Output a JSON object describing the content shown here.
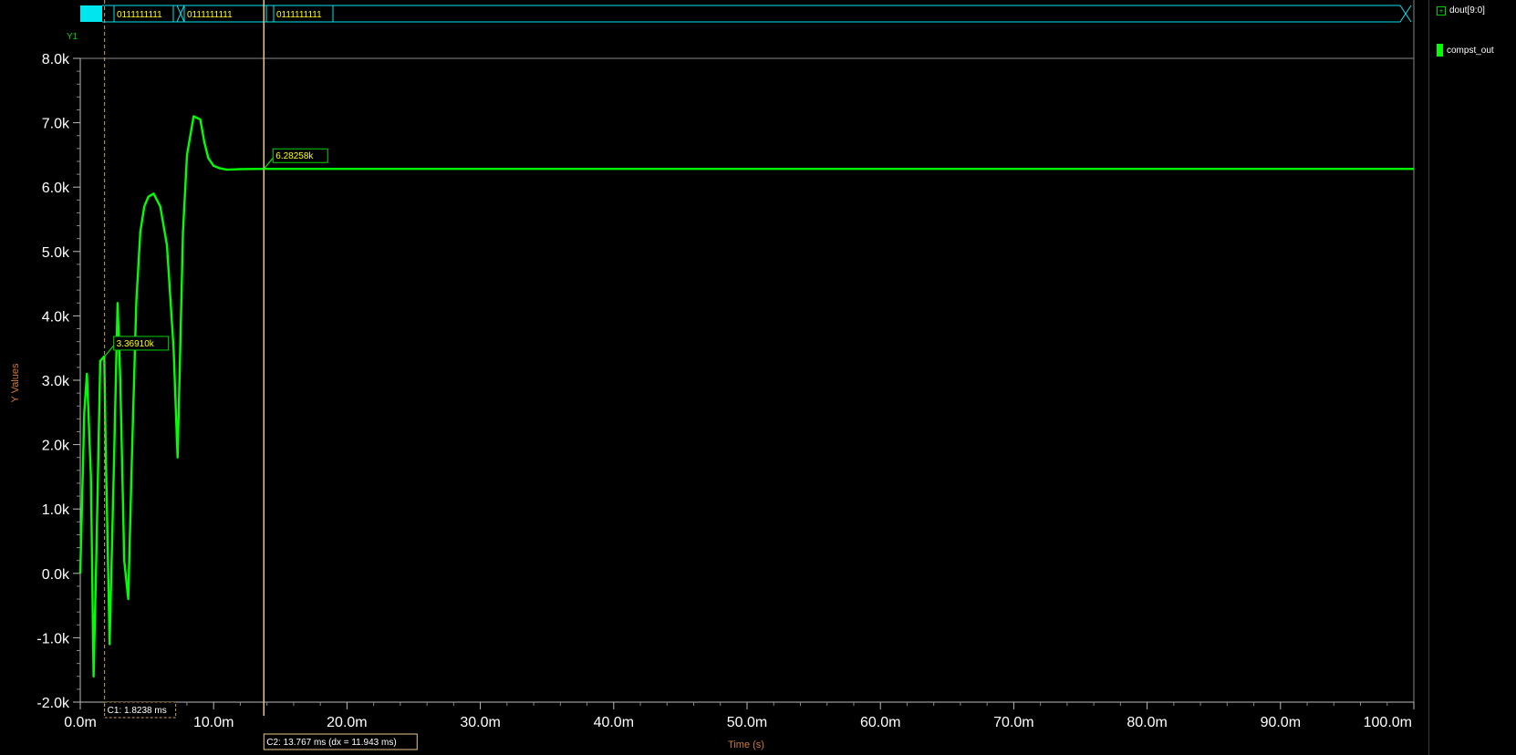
{
  "bus": {
    "values": [
      "0111111111",
      "0111111111",
      "0111111111"
    ],
    "color": "#00e5ee"
  },
  "legend": {
    "bus_name": "dout[9:0]",
    "signal_name": "compst_out",
    "expand_symbol": "+"
  },
  "cursors": {
    "c1": {
      "x_ms": 1.8238,
      "label": "C1: 1.8238 ms",
      "readout": "3.36910k",
      "style": "dashed"
    },
    "c2": {
      "x_ms": 13.767,
      "label": "C2: 13.767 ms (dx = 11.943 ms)",
      "readout": "6.28258k",
      "style": "solid"
    }
  },
  "colors": {
    "background": "#000000",
    "trace": "#00ff00",
    "bus": "#00e5ee",
    "cursor": "#c8a070",
    "readout": "#ffff00",
    "axis_label": "#d07a3a",
    "tick_text": "#ffffff"
  },
  "chart_data": {
    "type": "line",
    "title": "",
    "ylabel": "Y Values",
    "xlabel": "Time (s)",
    "axis_name": "Y1",
    "xlim": [
      0,
      100
    ],
    "ylim": [
      -2000,
      8000
    ],
    "x_unit": "ms",
    "y_ticks": [
      "8.0k",
      "7.0k",
      "6.0k",
      "5.0k",
      "4.0k",
      "3.0k",
      "2.0k",
      "1.0k",
      "0.0k",
      "-1.0k",
      "-2.0k"
    ],
    "y_tick_values": [
      8000,
      7000,
      6000,
      5000,
      4000,
      3000,
      2000,
      1000,
      0,
      -1000,
      -2000
    ],
    "x_ticks": [
      "0.0m",
      "10.0m",
      "20.0m",
      "30.0m",
      "40.0m",
      "50.0m",
      "60.0m",
      "70.0m",
      "80.0m",
      "90.0m",
      "100.0m"
    ],
    "x_tick_values": [
      0,
      10,
      20,
      30,
      40,
      50,
      60,
      70,
      80,
      90,
      100
    ],
    "grid": false,
    "series": [
      {
        "name": "compst_out",
        "x": [
          0,
          0.3,
          0.5,
          0.8,
          1.0,
          1.2,
          1.5,
          1.8,
          1.9,
          2.2,
          2.5,
          2.8,
          3.0,
          3.3,
          3.6,
          3.9,
          4.2,
          4.5,
          4.8,
          5.1,
          5.5,
          6.0,
          6.5,
          7.0,
          7.3,
          7.5,
          7.7,
          8.0,
          8.5,
          9.0,
          9.3,
          9.6,
          10.0,
          10.5,
          11.0,
          11.5,
          12.0,
          13.0,
          13.767,
          20,
          30,
          40,
          50,
          60,
          70,
          80,
          90,
          100
        ],
        "y": [
          0,
          2500,
          3100,
          1500,
          -1600,
          200,
          3300,
          3369,
          2000,
          -1100,
          1500,
          4200,
          3000,
          200,
          -400,
          2000,
          4200,
          5300,
          5700,
          5850,
          5900,
          5700,
          5100,
          3500,
          1800,
          3500,
          5300,
          6500,
          7100,
          7050,
          6700,
          6450,
          6330,
          6290,
          6270,
          6275,
          6280,
          6282,
          6282.58,
          6282.58,
          6282.58,
          6282.58,
          6282.58,
          6282.58,
          6282.58,
          6282.58,
          6282.58,
          6282.58
        ]
      }
    ]
  }
}
